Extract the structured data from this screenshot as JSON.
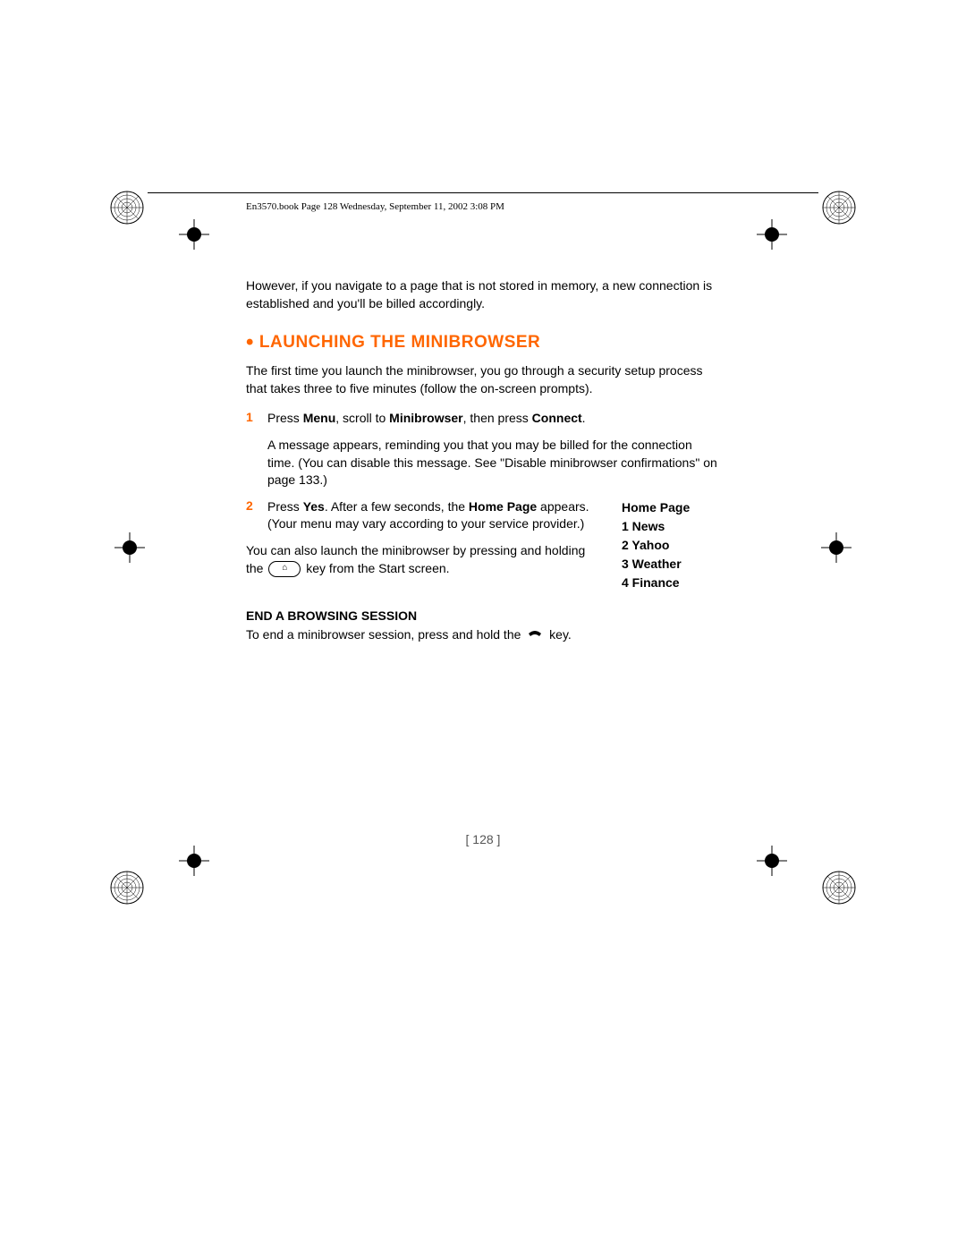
{
  "header": {
    "runningHead": "En3570.book  Page 128  Wednesday, September 11, 2002  3:08 PM"
  },
  "body": {
    "intro": "However, if you navigate to a page that is not stored in memory, a new connection is established and you'll be billed accordingly.",
    "sectionTitle": "LAUNCHING THE MINIBROWSER",
    "sectionIntro": "The first time you launch the minibrowser, you go through a security setup process that takes three to five minutes (follow the on-screen prompts).",
    "step1": {
      "num": "1",
      "text_pre": "Press ",
      "bold1": "Menu",
      "text_mid1": ", scroll to ",
      "bold2": "Minibrowser",
      "text_mid2": ", then press ",
      "bold3": "Connect",
      "text_end": ".",
      "sub": "A message appears, reminding you that you may be billed for the connection time. (You can disable this message. See \"Disable minibrowser confirmations\" on page 133.)"
    },
    "step2": {
      "num": "2",
      "text_pre": "Press ",
      "bold1": "Yes",
      "text_mid1": ". After a few seconds, the ",
      "bold2": "Home Page",
      "text_end": " appears. (Your menu may vary according to your service provider.)"
    },
    "alsoLaunch_pre": "You can also launch the minibrowser by pressing and holding the ",
    "alsoLaunch_post": " key from the Start screen.",
    "homePage": {
      "title": "Home Page",
      "items": [
        "1 News",
        "2 Yahoo",
        "3 Weather",
        "4 Finance"
      ]
    },
    "subHeading": "END A BROWSING SESSION",
    "endText_pre": "To end a minibrowser session, press and hold the ",
    "endText_post": " key."
  },
  "footer": {
    "pageNumber": "[ 128 ]"
  },
  "icons": {
    "homeKey": "⌂",
    "endKey": "end-call-icon"
  }
}
